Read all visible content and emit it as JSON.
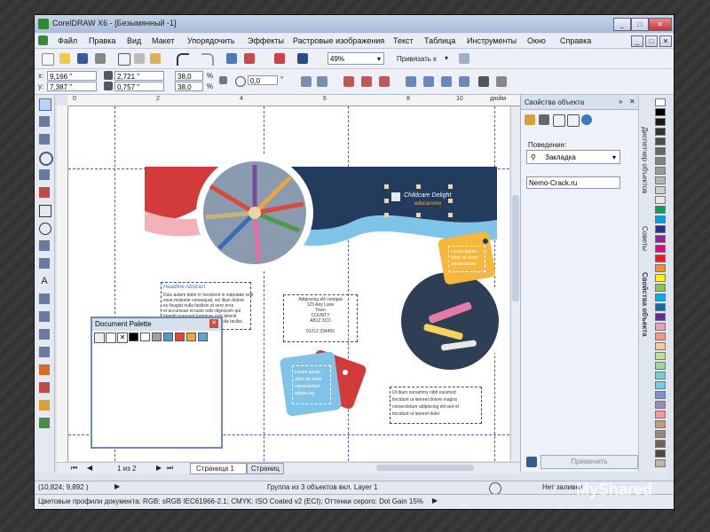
{
  "window": {
    "title": "CorelDRAW X6 - [Безымянный -1]",
    "min": "_",
    "max": "□",
    "close": "✕"
  },
  "menu": [
    "Файл",
    "Правка",
    "Вид",
    "Макет",
    "Упорядочить",
    "Эффекты",
    "Растровые изображения",
    "Текст",
    "Таблица",
    "Инструменты",
    "Окно",
    "Справка"
  ],
  "toolbar": {
    "zoom_value": "49%",
    "snap_label": "Привязать к",
    "x_label": "x:",
    "x_value": "9,166 \"",
    "y_label": "y:",
    "y_value": "7,387 \"",
    "w_value": "2,721 \"",
    "h_value": "0,757 \"",
    "scale_x": "38,0",
    "scale_y": "38,0",
    "percent": "%",
    "angle_value": "0,0",
    "degree": "°"
  },
  "ruler": {
    "units": "дюйм",
    "h_ticks": [
      "0",
      "2",
      "4",
      "6",
      "8",
      "10"
    ]
  },
  "canvas": {
    "brand_line1": "Childcare Delight",
    "brand_line2": "educaroma",
    "intro_title": "Headline Abstract",
    "intro_lines": [
      "Duis autem dolor in hendrerit in vulputate velit",
      "esse molestie consequat, vel illum dolore",
      "eu feugiat nulla facilisis at vero eros",
      "et accumsan et iusto odio dignissim qui",
      "blandit praesent luptatum zzril delenit",
      "augue duis dolore te feugait nulla facilisi."
    ],
    "address_lines": [
      "Adipiscing elit volutpat",
      "123 Any Lane",
      "Town",
      "COUNTY",
      "AB12 3CD",
      "",
      "01212 334455"
    ],
    "bottom_lines": [
      "Ut diam nonummy nibh euismod",
      "tincidunt ut laoreet dolore magna",
      "consectetuer adipiscing elit sed et",
      "tincidunt ut laoreet dolor"
    ],
    "tag_yellow": [
      "Lorem ipsum",
      "dolor sit amet",
      "consectetuer"
    ],
    "tag_blue": [
      "Lorem ipsum",
      "dolor sit amet",
      "consectetuer",
      "adipiscing"
    ]
  },
  "doc_palette": {
    "title": "Document Palette",
    "close": "✕",
    "colors": [
      "#000000",
      "#ffffff",
      "#a0a0a0",
      "#4e9bd0",
      "#d94a3b",
      "#f2a532",
      "#5aa4d8"
    ]
  },
  "properties": {
    "title": "Свойства объекта",
    "behavior_label": "Поведение:",
    "behavior_value": "Закладка",
    "name_value": "Nemo-Crack.ru",
    "apply_button": "Применить"
  },
  "docker_tabs": [
    "Диспетчер объектов",
    "Советы",
    "Свойства объекта"
  ],
  "pages": {
    "counter": "1 из 2",
    "page1": "Страница 1",
    "page2": "Страниц"
  },
  "status": {
    "coords": "(10,824; 9,892 )",
    "selection": "Группа из 3 объектов вкл. Layer 1",
    "color_profiles": "Цветовые профили документа: RGB: sRGB IEC61966-2.1; CMYK: ISO Coated v2 (ECI); Оттенки серого: Dot Gain 15%",
    "fill_label": "Нет заливки"
  },
  "palette_colors": [
    "#ffffff",
    "#000000",
    "#1a1a1a",
    "#333333",
    "#4d4d4d",
    "#666666",
    "#808080",
    "#999999",
    "#b3b3b3",
    "#cccccc",
    "#e6e6e6",
    "#00a651",
    "#00a0e0",
    "#2e3192",
    "#92278f",
    "#ec008c",
    "#ed1c24",
    "#f7941d",
    "#fff200",
    "#8dc63f",
    "#00aeef",
    "#0072bc",
    "#662d91",
    "#f49ac2",
    "#f7977a",
    "#fdc68a",
    "#c4df9b",
    "#a3d39c",
    "#7accc8",
    "#6dcff6",
    "#8393ca",
    "#a187be",
    "#f5989d",
    "#c69c6d",
    "#998675",
    "#736357",
    "#534741",
    "#c7b299"
  ],
  "colors": {
    "accent": "#2a4a8a",
    "navy": "#233b5d",
    "red": "#d33a3a",
    "yellow": "#f6b73c",
    "lightblue": "#7fc4e8"
  },
  "watermark": "MyShared"
}
